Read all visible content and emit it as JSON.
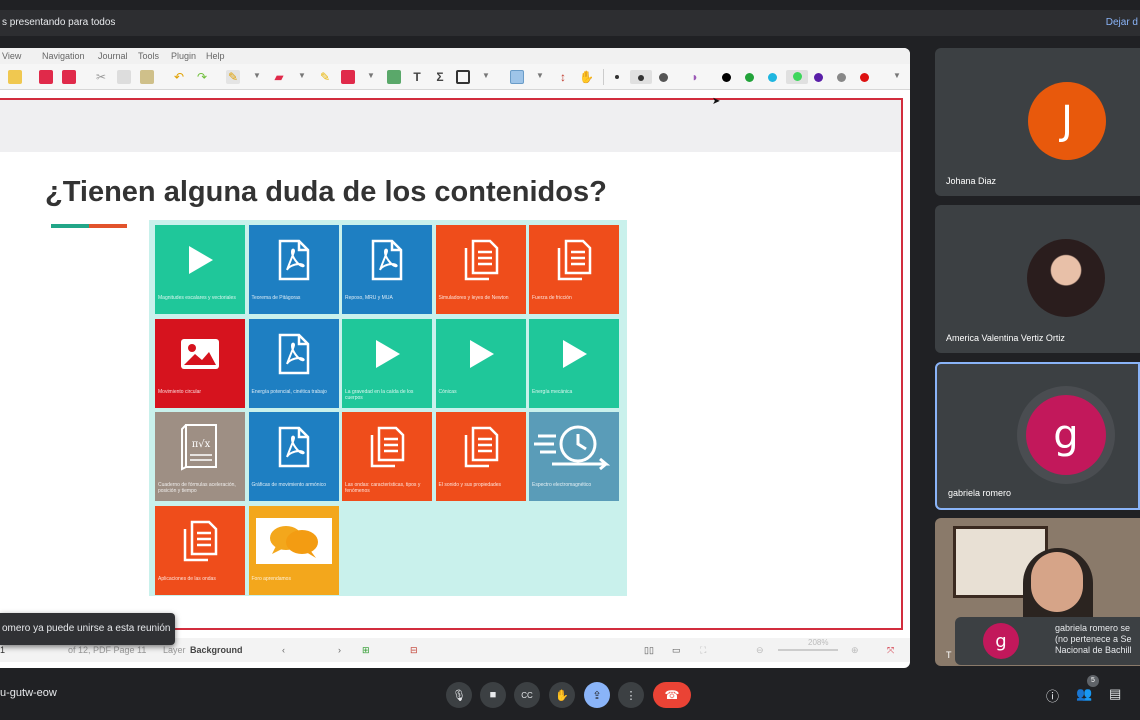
{
  "meet": {
    "presenting_banner": "s presentando para todos",
    "stop_label": "Dejar d",
    "meeting_code": "u-gutw-eow",
    "toast": "omero ya puede unirse a esta reunión",
    "participant_count": "5"
  },
  "app": {
    "menu": [
      "View",
      "Navigation",
      "Journal",
      "Tools",
      "Plugin",
      "Help"
    ],
    "status": {
      "page": "1",
      "of_pages": "of 12, PDF Page 11",
      "layer_label": "Layer",
      "layer_value": "Background",
      "zoom": "208%"
    }
  },
  "slide": {
    "title": "¿Tienen alguna duda de los contenidos?",
    "tiles": [
      {
        "caption": "Magnitudes escalares y vectoriales",
        "icon": "play-icon",
        "color": "#1fc79a"
      },
      {
        "caption": "Teorema de Pitágoras",
        "icon": "pdf-icon",
        "color": "#1e7fc2"
      },
      {
        "caption": "Reposo, MRU y MUA",
        "icon": "pdf-icon",
        "color": "#1e7fc2"
      },
      {
        "caption": "Simuladores y leyes de Newton",
        "icon": "document-icon",
        "color": "#ef4d1b"
      },
      {
        "caption": "Fuerza de fricción",
        "icon": "document-icon",
        "color": "#ef4d1b"
      },
      {
        "caption": "Movimiento circular",
        "icon": "image-icon",
        "color": "#d6131e"
      },
      {
        "caption": "Energía potencial, cinética trabajo",
        "icon": "pdf-icon",
        "color": "#1e7fc2"
      },
      {
        "caption": "La gravedad en la caída de los cuerpos",
        "icon": "play-icon",
        "color": "#1fc79a"
      },
      {
        "caption": "Cónicas",
        "icon": "play-icon",
        "color": "#1fc79a"
      },
      {
        "caption": "Energía mecánica",
        "icon": "play-icon",
        "color": "#1fc79a"
      },
      {
        "caption": "Cuaderno de fórmulas aceleración, posición y tiempo",
        "icon": "formula-book-icon",
        "color": "#9e8f84"
      },
      {
        "caption": "Gráficas de movimiento armónico",
        "icon": "pdf-icon",
        "color": "#1e7fc2"
      },
      {
        "caption": "Las ondas: características, tipos y fenómenos",
        "icon": "document-icon",
        "color": "#ef4d1b"
      },
      {
        "caption": "El sonido y sus propiedades",
        "icon": "document-icon",
        "color": "#ef4d1b"
      },
      {
        "caption": "Espectro electromagnético",
        "icon": "fast-clock-icon",
        "color": "#5a9cb8"
      },
      {
        "caption": "Aplicaciones de las ondas",
        "icon": "document-icon",
        "color": "#ef4d1b"
      },
      {
        "caption": "Foro aprendamos",
        "icon": "chat-bubbles-icon",
        "color": "#f3a71c"
      }
    ]
  },
  "participants": [
    {
      "name": "Johana Diaz",
      "initial": "J",
      "color": "#e8590c"
    },
    {
      "name": "America Valentina Vertiz Ortiz",
      "initial": "",
      "color": "#1a1a2e"
    },
    {
      "name": "gabriela romero",
      "initial": "g",
      "color": "#c2185b"
    },
    {
      "name": "T",
      "initial": "",
      "color": "#5d4a3a"
    }
  ],
  "overlay": {
    "initial": "g",
    "line1": "gabriela romero se",
    "line2": "(no pertenece a Se",
    "line3": "Nacional de Bachill"
  },
  "toolbar_colors": [
    "#000000",
    "#22a33a",
    "#1fb6e0",
    "#3dd65b",
    "#5a1fa8",
    "#888888",
    "#dd1111"
  ]
}
